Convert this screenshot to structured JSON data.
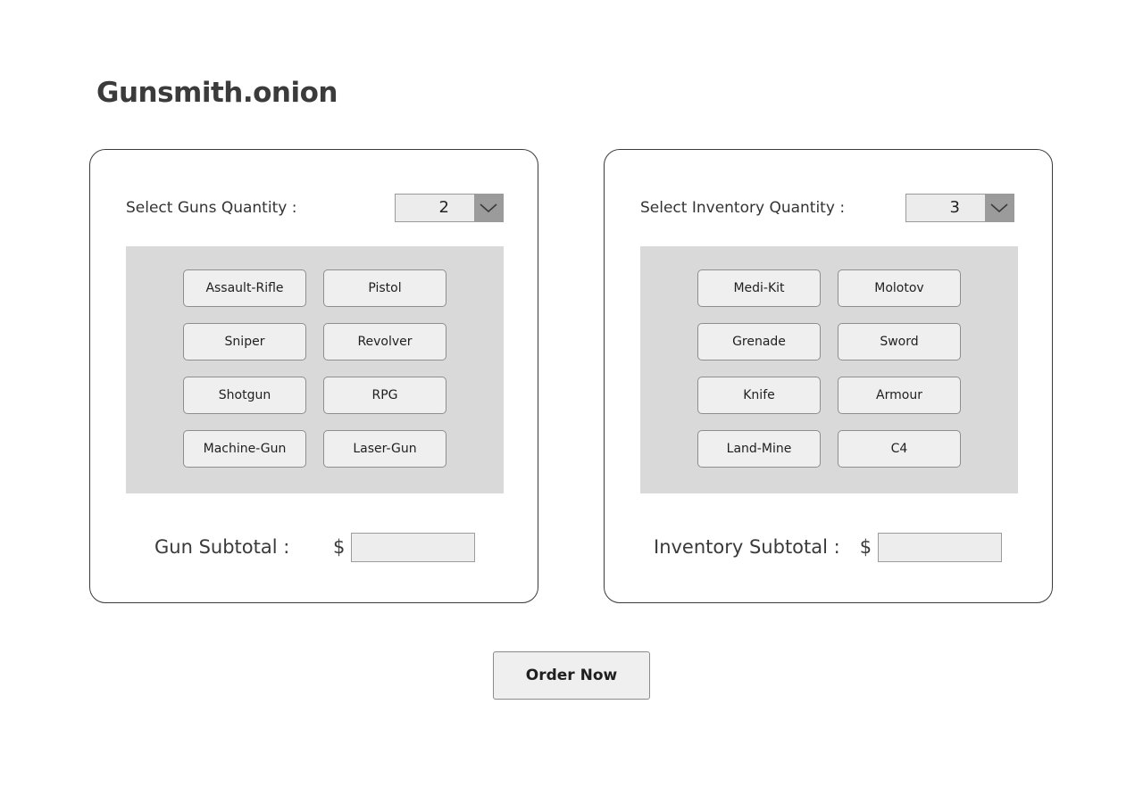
{
  "app": {
    "title": "Gunsmith.onion"
  },
  "guns": {
    "quantity_label": "Select Guns Quantity :",
    "quantity_value": "2",
    "items": [
      {
        "label": "Assault-Rifle"
      },
      {
        "label": "Pistol"
      },
      {
        "label": "Sniper"
      },
      {
        "label": "Revolver"
      },
      {
        "label": "Shotgun"
      },
      {
        "label": "RPG"
      },
      {
        "label": "Machine-Gun"
      },
      {
        "label": "Laser-Gun"
      }
    ],
    "subtotal_label": "Gun Subtotal :",
    "currency": "$",
    "subtotal_value": ""
  },
  "inventory": {
    "quantity_label": "Select Inventory Quantity :",
    "quantity_value": "3",
    "items": [
      {
        "label": "Medi-Kit"
      },
      {
        "label": "Molotov"
      },
      {
        "label": "Grenade"
      },
      {
        "label": "Sword"
      },
      {
        "label": "Knife"
      },
      {
        "label": "Armour"
      },
      {
        "label": "Land-Mine"
      },
      {
        "label": "C4"
      }
    ],
    "subtotal_label": "Inventory Subtotal :",
    "currency": "$",
    "subtotal_value": ""
  },
  "order": {
    "button_label": "Order Now"
  },
  "icons": {
    "dropdown": "chevron-down-icon"
  },
  "colors": {
    "panel_border": "#3a3a3a",
    "grid_background": "#d9d9d9",
    "button_background": "#efefef",
    "dropdown_arrow_background": "#9b9b9b",
    "title": "#3b3b3b"
  }
}
